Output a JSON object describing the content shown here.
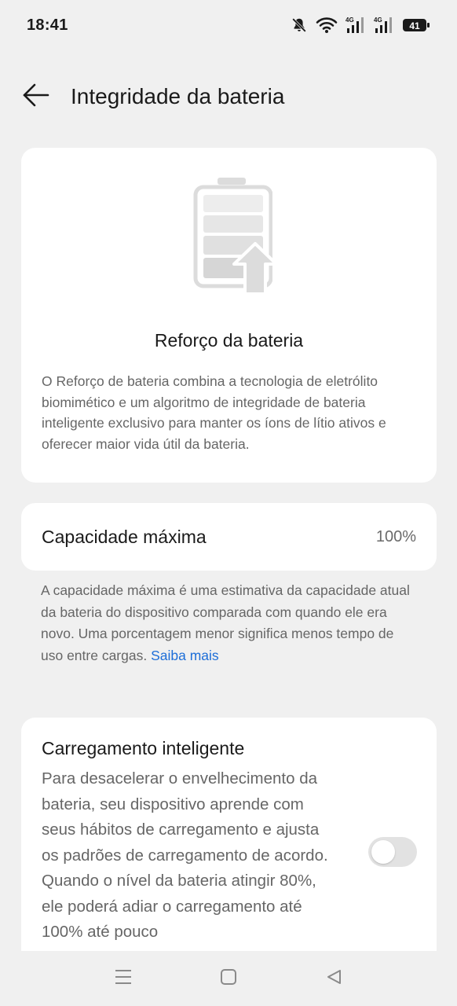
{
  "status_bar": {
    "time": "18:41",
    "icons": [
      "bell-muted-icon",
      "wifi-icon",
      "signal-4g-icon",
      "signal-4g-icon",
      "battery-icon"
    ],
    "network_label_1": "4G",
    "network_label_2": "4G",
    "battery_level": "41"
  },
  "header": {
    "back_icon": "arrow-left-icon",
    "title": "Integridade da bateria"
  },
  "hero_card": {
    "illustration": "battery-boost-icon",
    "title": "Reforço da bateria",
    "description": "O Reforço de bateria combina a tecnologia de eletrólito biomimético e um algoritmo de integridade de bateria inteligente exclusivo para manter os íons de lítio ativos e oferecer maior vida útil da bateria."
  },
  "capacity_card": {
    "label": "Capacidade máxima",
    "value": "100%"
  },
  "capacity_note": {
    "text": "A capacidade máxima é uma estimativa da capacidade atual da bateria do dispositivo comparada com quando ele era novo. Uma porcentagem menor significa menos tempo de uso entre cargas. ",
    "link": "Saiba mais"
  },
  "smart_charging_card": {
    "title": "Carregamento inteligente",
    "description": "Para desacelerar o envelhecimento da bateria, seu dispositivo aprende com seus hábitos de carregamento e ajusta os padrões de carregamento de acordo. Quando o nível da bateria atingir 80%, ele poderá adiar o carregamento até 100% até pouco",
    "toggle_on": false
  },
  "nav_bar": {
    "items": [
      "menu-icon",
      "home-icon",
      "back-triangle-icon"
    ]
  },
  "colors": {
    "background": "#f0f0f0",
    "card": "#ffffff",
    "link": "#1d6ed8",
    "secondary_text": "#666666"
  }
}
